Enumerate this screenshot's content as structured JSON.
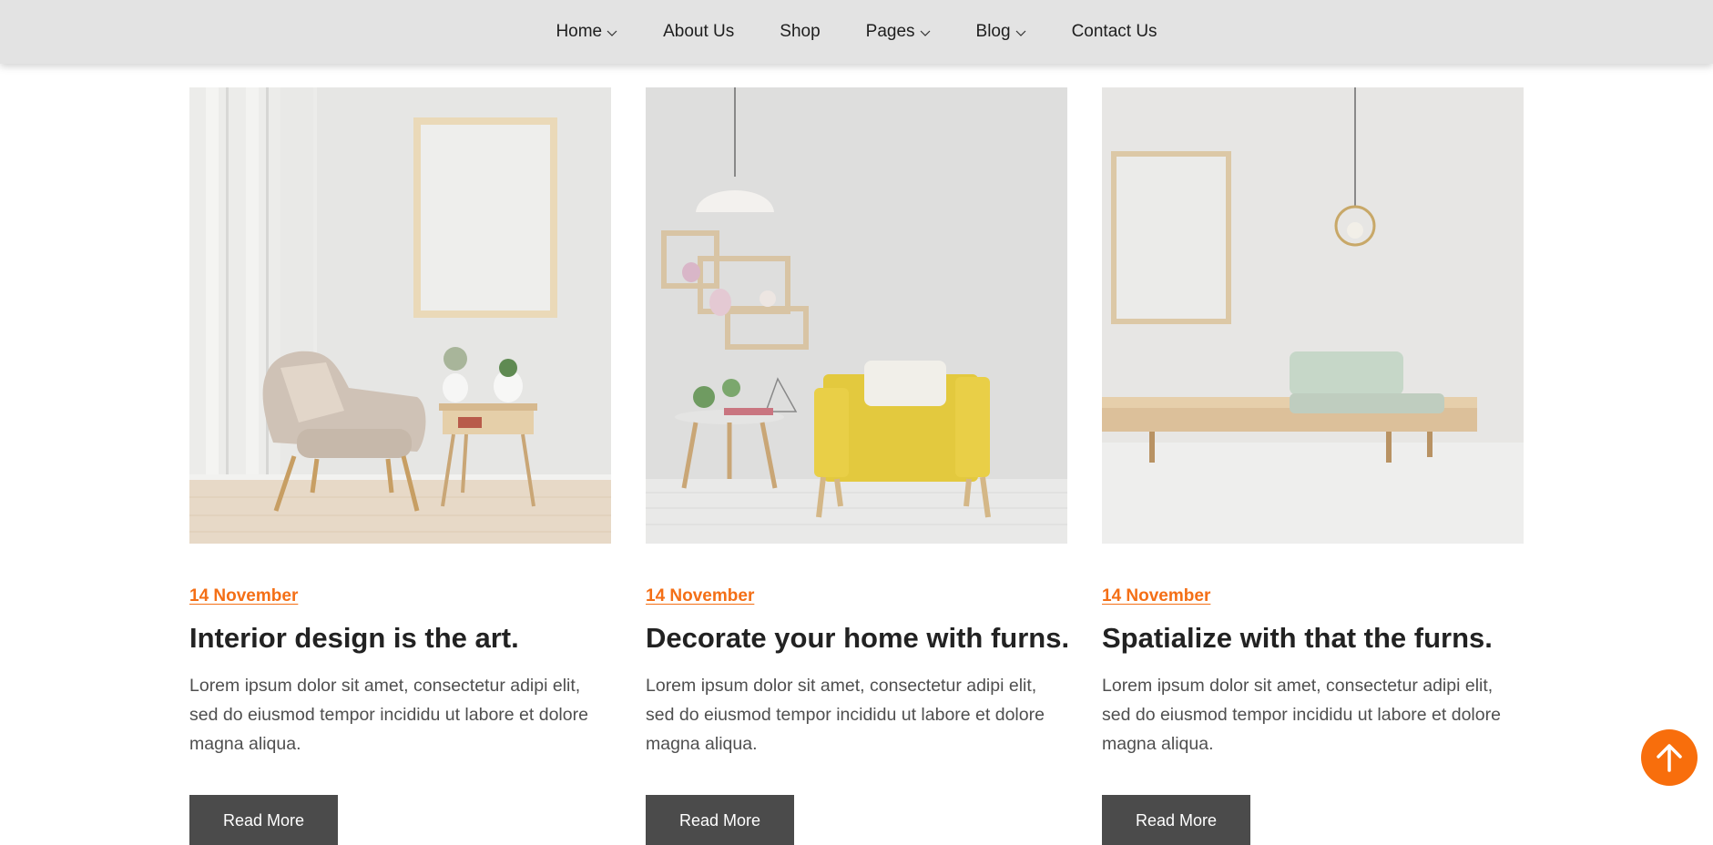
{
  "nav": {
    "items": [
      {
        "label": "Home",
        "has_dropdown": true
      },
      {
        "label": "About Us",
        "has_dropdown": false
      },
      {
        "label": "Shop",
        "has_dropdown": false
      },
      {
        "label": "Pages",
        "has_dropdown": true
      },
      {
        "label": "Blog",
        "has_dropdown": true
      },
      {
        "label": "Contact Us",
        "has_dropdown": false
      }
    ]
  },
  "posts": [
    {
      "date": "14 November",
      "title": "Interior design is the art.",
      "excerpt": "Lorem ipsum dolor sit amet, consectetur adipi elit, sed do eiusmod tempor incididu ut labore et dolore magna aliqua.",
      "button": "Read More"
    },
    {
      "date": "14 November",
      "title": "Decorate your home with furns.",
      "excerpt": "Lorem ipsum dolor sit amet, consectetur adipi elit, sed do eiusmod tempor incididu ut labore et dolore magna aliqua.",
      "button": "Read More"
    },
    {
      "date": "14 November",
      "title": "Spatialize with that the furns.",
      "excerpt": "Lorem ipsum dolor sit amet, consectetur adipi elit, sed do eiusmod tempor incididu ut labore et dolore magna aliqua.",
      "button": "Read More"
    }
  ],
  "colors": {
    "accent": "#f46f16",
    "button_bg": "#4b4b4b",
    "nav_bg": "#e3e3e3"
  },
  "icons": {
    "dropdown": "chevron-down-icon",
    "scroll_top": "arrow-up-icon"
  }
}
